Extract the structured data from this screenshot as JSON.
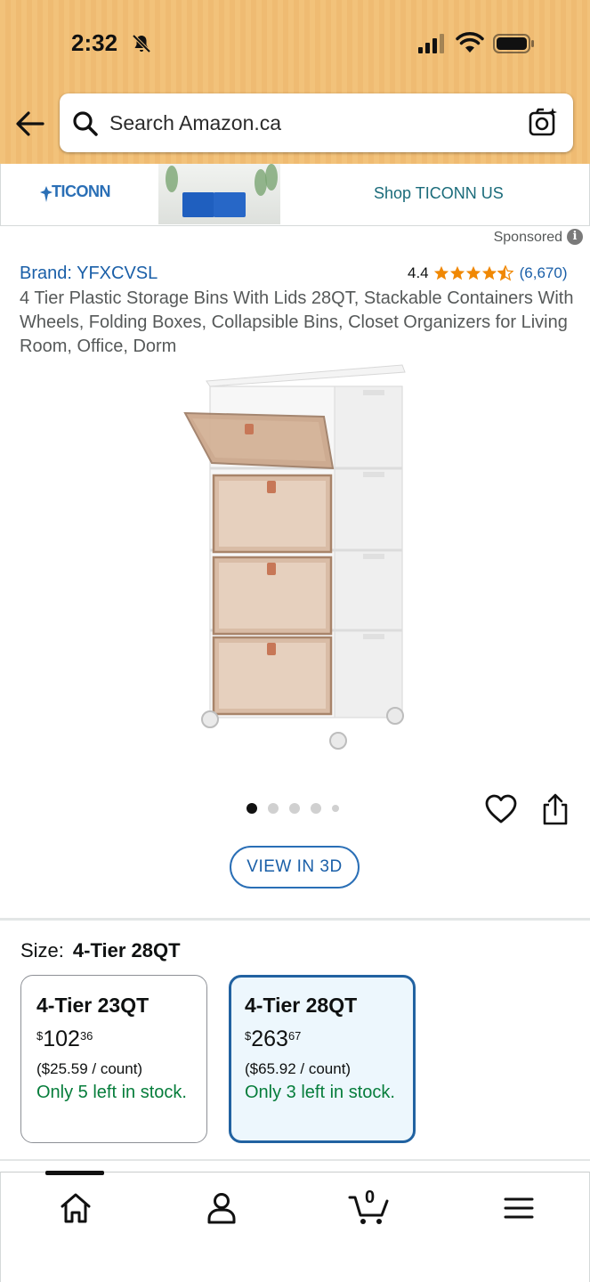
{
  "status_bar": {
    "time": "2:32"
  },
  "search": {
    "placeholder": "Search Amazon.ca"
  },
  "sponsored_banner": {
    "brand_logo_text": "TICONN",
    "link_label": "Shop TICONN US"
  },
  "sponsored_label": "Sponsored",
  "product": {
    "brand": "Brand: YFXCVSL",
    "rating": "4.4",
    "stars": 4.4,
    "review_count": "(6,670)",
    "title": "4 Tier Plastic Storage Bins With Lids 28QT, Stackable Containers With Wheels, Folding Boxes, Collapsible Bins, Closet Organizers for Living Room, Office, Dorm"
  },
  "gallery": {
    "image_count": 5,
    "active_index": 0
  },
  "view_3d_label": "VIEW IN 3D",
  "size": {
    "label": "Size:",
    "selected": "4-Tier 28QT",
    "options": [
      {
        "name": "4-Tier 23QT",
        "currency": "$",
        "whole": "102",
        "fraction": "36",
        "unit_price": "($25.59 / count)",
        "stock": "Only 5 left in stock."
      },
      {
        "name": "4-Tier 28QT",
        "currency": "$",
        "whole": "263",
        "fraction": "67",
        "unit_price": "($65.92 / count)",
        "stock": "Only 3 left in stock."
      }
    ]
  },
  "bottom_nav": {
    "cart_count": "0"
  },
  "colors": {
    "header_bg": "#f2c27a",
    "link_blue": "#1a5fa8",
    "stock_green": "#067d3b",
    "star_orange": "#f08804",
    "selected_border": "#2162a1"
  }
}
